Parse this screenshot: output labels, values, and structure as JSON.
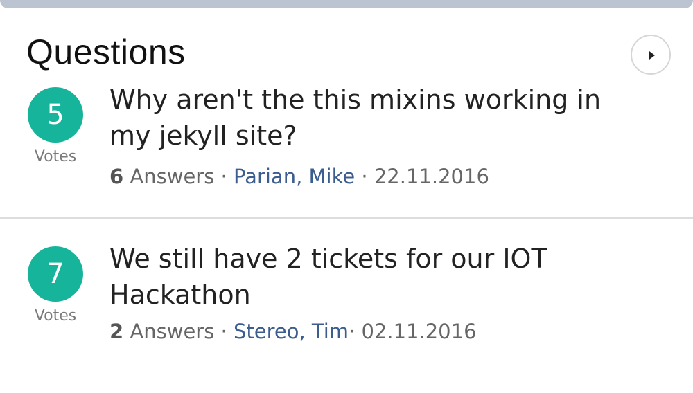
{
  "header": {
    "title": "Questions",
    "next_icon": "chevron-right-icon"
  },
  "colors": {
    "accent": "#15b49b",
    "author_link": "#3b5e8f",
    "top_bar": "#bcc3d1"
  },
  "questions": [
    {
      "votes": "5",
      "votes_label": "Votes",
      "title": "Why aren't the this mixins working in my jekyll site?",
      "answers_count": "6",
      "answers_label": "Answers",
      "sep1": " · ",
      "author": "Parian, Mike",
      "sep2": " · ",
      "date": "22.11.2016"
    },
    {
      "votes": "7",
      "votes_label": "Votes",
      "title": "We still have 2 tickets for our IOT Hackathon",
      "answers_count": "2",
      "answers_label": "Answers",
      "sep1": " · ",
      "author": "Stereo, Tim",
      "sep2": "· ",
      "date": "02.11.2016"
    }
  ]
}
